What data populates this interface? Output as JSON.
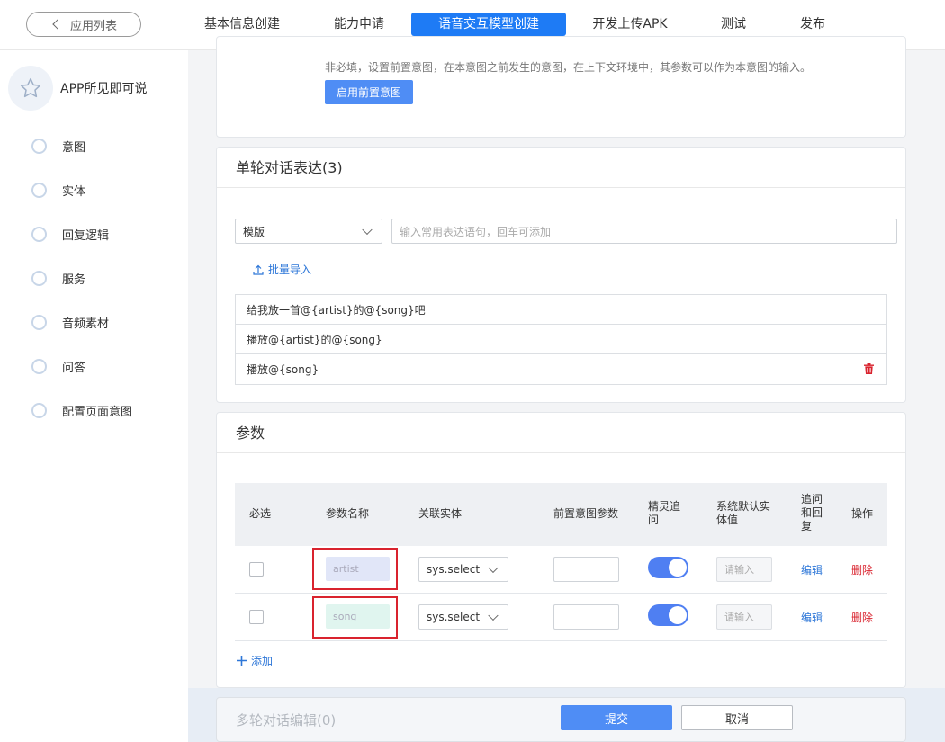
{
  "nav": {
    "back_label": "应用列表",
    "tabs": [
      {
        "label": "基本信息创建"
      },
      {
        "label": "能力申请"
      },
      {
        "label": "语音交互模型创建",
        "active": true
      },
      {
        "label": "开发上传APK"
      },
      {
        "label": "测试"
      },
      {
        "label": "发布"
      }
    ]
  },
  "sidebar": {
    "app_name": "APP所见即可说",
    "items": [
      {
        "label": "意图"
      },
      {
        "label": "实体"
      },
      {
        "label": "回复逻辑"
      },
      {
        "label": "服务"
      },
      {
        "label": "音频素材"
      },
      {
        "label": "问答"
      },
      {
        "label": "配置页面意图"
      }
    ]
  },
  "pre_intent": {
    "hint": "非必填，设置前置意图，在本意图之前发生的意图，在上下文环境中，其参数可以作为本意图的输入。",
    "button_label": "启用前置意图"
  },
  "single_turn": {
    "title": "单轮对话表达(3)",
    "template_select": "模版",
    "input_placeholder": "输入常用表达语句，回车可添加",
    "bulk_import_label": "批量导入",
    "expressions": [
      "给我放一首@{artist}的@{song}吧",
      "播放@{artist}的@{song}",
      "播放@{song}"
    ]
  },
  "params": {
    "title": "参数",
    "headers": {
      "required": "必选",
      "name": "参数名称",
      "entity": "关联实体",
      "pre_param": "前置意图参数",
      "elf_ask": "精灵追问",
      "sys_default": "系统默认实体值",
      "ask_reply": "追问和回复",
      "action": "操作"
    },
    "rows": [
      {
        "name": "artist",
        "entity": "sys.select",
        "sys_default_placeholder": "请输入",
        "edit": "编辑",
        "delete": "删除",
        "name_bg": "#e1e6f8"
      },
      {
        "name": "song",
        "entity": "sys.select",
        "sys_default_placeholder": "请输入",
        "edit": "编辑",
        "delete": "删除",
        "name_bg": "#e0f5ef"
      }
    ],
    "add_label": "添加"
  },
  "footer": {
    "multi_turn_title": "多轮对话编辑(0)",
    "submit_label": "提交",
    "cancel_label": "取消"
  },
  "colors": {
    "accent": "#1e7bf5",
    "primary_button": "#4f8df5",
    "danger": "#d9232e",
    "link": "#2e77d8"
  }
}
